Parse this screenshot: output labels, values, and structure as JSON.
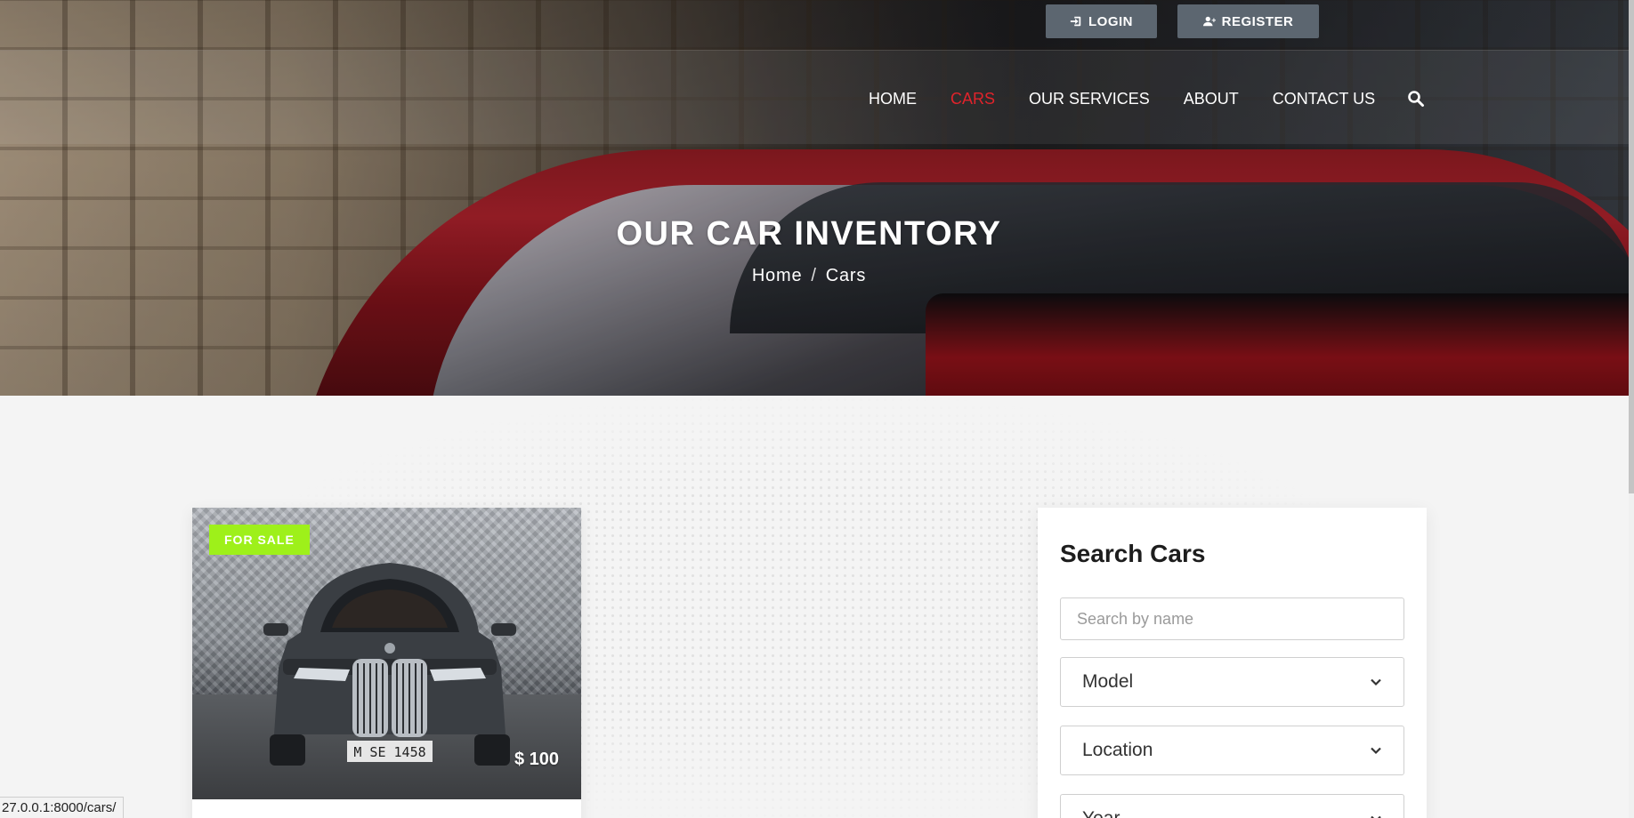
{
  "header": {
    "login_label": "LOGIN",
    "register_label": "REGISTER",
    "nav": [
      {
        "label": "HOME",
        "active": false
      },
      {
        "label": "CARS",
        "active": true
      },
      {
        "label": "OUR SERVICES",
        "active": false
      },
      {
        "label": "ABOUT",
        "active": false
      },
      {
        "label": "CONTACT US",
        "active": false
      }
    ],
    "search_icon": "search-icon",
    "active_color": "#e0232b"
  },
  "hero": {
    "title": "OUR CAR INVENTORY",
    "breadcrumb": {
      "home": "Home",
      "separator": "/",
      "current": "Cars"
    }
  },
  "car_card": {
    "badge": "FOR SALE",
    "badge_color": "#9ef01a",
    "price": "$ 100",
    "plate": "M SE 1458"
  },
  "search": {
    "title": "Search Cars",
    "name_placeholder": "Search by name",
    "model_label": "Model",
    "location_label": "Location",
    "year_label": "Year"
  },
  "status_bar": {
    "url": "27.0.0.1:8000/cars/"
  }
}
